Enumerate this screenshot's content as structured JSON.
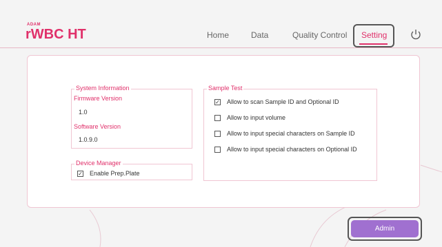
{
  "brand": {
    "small": "ADAM",
    "name": "WBC HT",
    "prefix": "r"
  },
  "nav": {
    "home": "Home",
    "data": "Data",
    "quality_control": "Quality Control",
    "setting": "Setting"
  },
  "system_information": {
    "title": "System Information",
    "firmware_label": "Firmware Version",
    "firmware_value": "1.0",
    "software_label": "Software Version",
    "software_value": "1.0.9.0"
  },
  "device_manager": {
    "title": "Device Manager",
    "enable_prep_plate": {
      "label": "Enable Prep.Plate",
      "checked": true
    }
  },
  "sample_test": {
    "title": "Sample Test",
    "options": [
      {
        "label": "Allow to scan Sample ID and Optional ID",
        "checked": true
      },
      {
        "label": "Allow to input volume",
        "checked": false
      },
      {
        "label": "Allow to input special characters on Sample ID",
        "checked": false
      },
      {
        "label": "Allow to input special characters on Optional ID",
        "checked": false
      }
    ]
  },
  "admin_button": "Admin",
  "colors": {
    "accent": "#e0306a",
    "admin": "#a070d0",
    "border": "#f0c5d2"
  }
}
